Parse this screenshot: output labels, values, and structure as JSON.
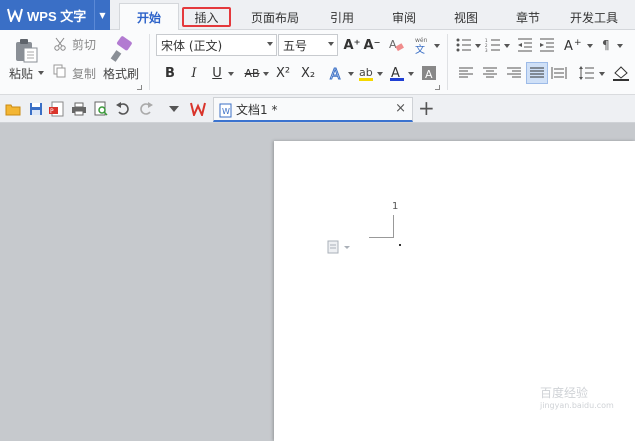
{
  "app": {
    "title": "WPS 文字",
    "accent": "#3a6fc6"
  },
  "menu": {
    "tabs": [
      {
        "label": "开始",
        "active": true
      },
      {
        "label": "插入",
        "highlighted": true
      },
      {
        "label": "页面布局"
      },
      {
        "label": "引用"
      },
      {
        "label": "审阅"
      },
      {
        "label": "视图"
      },
      {
        "label": "章节"
      },
      {
        "label": "开发工具"
      }
    ]
  },
  "ribbon": {
    "clipboard": {
      "paste_label": "粘贴",
      "cut_label": "剪切",
      "copy_label": "复制",
      "format_painter_label": "格式刷"
    },
    "font": {
      "font_name": "宋体 (正文)",
      "font_size": "五号",
      "bold": "B",
      "italic": "I",
      "underline": "U",
      "strike": "AB",
      "superscript": "X²",
      "subscript": "X₂",
      "grow": "A⁺",
      "shrink": "A⁻",
      "font_color_accent": "#1f3fd4",
      "highlight_accent": "#f5d800"
    }
  },
  "doc_tab": {
    "name": "文档1 *",
    "close": "×",
    "new": "+"
  },
  "document": {
    "page_number": "1"
  },
  "watermark": {
    "text": "百度经验",
    "sub": "jingyan.baidu.com"
  }
}
